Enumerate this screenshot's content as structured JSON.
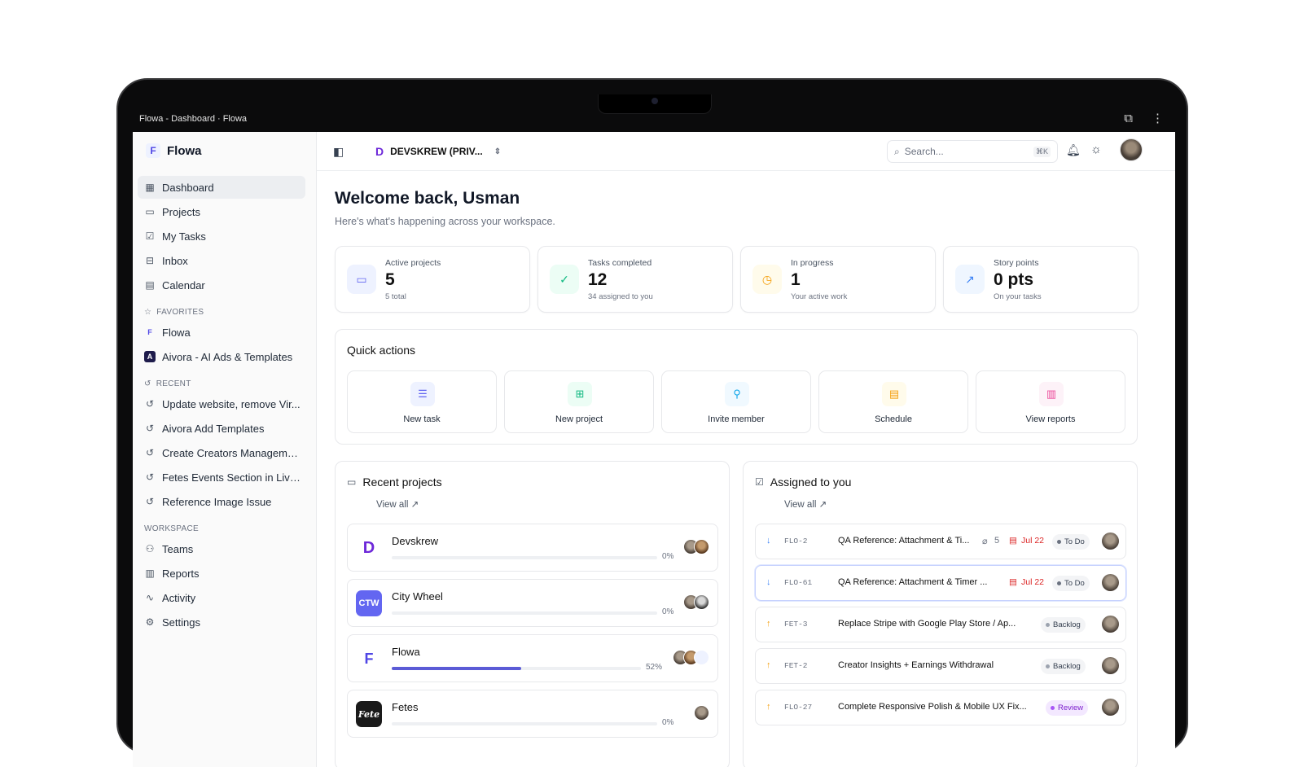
{
  "window": {
    "title": "Flowa - Dashboard · Flowa"
  },
  "sidebar": {
    "brand": "Flowa",
    "nav": [
      {
        "label": "Dashboard",
        "icon": "grid-icon"
      },
      {
        "label": "Projects",
        "icon": "folder-icon"
      },
      {
        "label": "My Tasks",
        "icon": "checkbox-icon"
      },
      {
        "label": "Inbox",
        "icon": "inbox-icon"
      },
      {
        "label": "Calendar",
        "icon": "calendar-icon"
      }
    ],
    "favorites_label": "FAVORITES",
    "favorites": [
      {
        "label": "Flowa"
      },
      {
        "label": "Aivora - AI Ads & Templates"
      }
    ],
    "recent_label": "RECENT",
    "recent": [
      {
        "label": "Update website, remove Vir..."
      },
      {
        "label": "Aivora Add Templates"
      },
      {
        "label": "Create Creators Manageme..."
      },
      {
        "label": "Fetes Events Section in Live ..."
      },
      {
        "label": "Reference Image Issue"
      }
    ],
    "workspace_label": "WORKSPACE",
    "workspace": [
      {
        "label": "Teams"
      },
      {
        "label": "Reports"
      },
      {
        "label": "Activity"
      },
      {
        "label": "Settings"
      }
    ]
  },
  "topbar": {
    "workspace_name": "DEVSKREW (PRIV...",
    "search_placeholder": "Search...",
    "search_shortcut": "⌘K"
  },
  "main": {
    "welcome": "Welcome back, Usman",
    "subtitle": "Here's what's happening across your workspace.",
    "stats": [
      {
        "label": "Active projects",
        "value": "5",
        "hint": "5 total",
        "color": "#6366f1"
      },
      {
        "label": "Tasks completed",
        "value": "12",
        "hint": "34 assigned to you",
        "color": "#10b981"
      },
      {
        "label": "In progress",
        "value": "1",
        "hint": "Your active work",
        "color": "#f59e0b"
      },
      {
        "label": "Story points",
        "value": "0 pts",
        "hint": "On your tasks",
        "color": "#3b82f6"
      }
    ],
    "quick_actions_title": "Quick actions",
    "quick_actions": [
      {
        "label": "New task",
        "color": "#6366f1"
      },
      {
        "label": "New project",
        "color": "#10b981"
      },
      {
        "label": "Invite member",
        "color": "#0ea5e9"
      },
      {
        "label": "Schedule",
        "color": "#f59e0b"
      },
      {
        "label": "View reports",
        "color": "#ec4899"
      }
    ],
    "recent_projects": {
      "title": "Recent projects",
      "view_all": "View all ↗",
      "items": [
        {
          "name": "Devskrew",
          "progress_label": "0%",
          "progress": 0
        },
        {
          "name": "City Wheel",
          "progress_label": "0%",
          "progress": 0,
          "logo_text": "CTW"
        },
        {
          "name": "Flowa",
          "progress_label": "52%",
          "progress": 0.52
        },
        {
          "name": "Fetes",
          "progress_label": "0%",
          "progress": 0,
          "logo_text": "Fete"
        }
      ]
    },
    "assigned": {
      "title": "Assigned to you",
      "view_all": "View all ↗",
      "items": [
        {
          "id": "FLO-2",
          "title": "QA Reference: Attachment & Ti...",
          "attachments": "5",
          "due": "Jul 22",
          "status": "To Do",
          "priority": "down"
        },
        {
          "id": "FLO-61",
          "title": "QA Reference: Attachment & Timer ...",
          "due": "Jul 22",
          "status": "To Do",
          "priority": "down"
        },
        {
          "id": "FET-3",
          "title": "Replace Stripe with Google Play Store / Ap...",
          "status": "Backlog",
          "priority": "up"
        },
        {
          "id": "FET-2",
          "title": "Creator Insights + Earnings Withdrawal",
          "status": "Backlog",
          "priority": "up"
        },
        {
          "id": "FLO-27",
          "title": "Complete Responsive Polish & Mobile UX Fix...",
          "status": "Review",
          "priority": "up"
        }
      ]
    }
  }
}
